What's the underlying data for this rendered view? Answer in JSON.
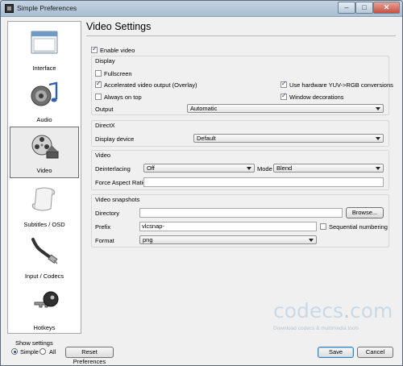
{
  "window": {
    "title": "Simple Preferences"
  },
  "sidebar": {
    "items": [
      {
        "label": "Interface",
        "icon": "interface-icon"
      },
      {
        "label": "Audio",
        "icon": "audio-icon"
      },
      {
        "label": "Video",
        "icon": "video-icon",
        "active": true
      },
      {
        "label": "Subtitles / OSD",
        "icon": "subtitles-icon"
      },
      {
        "label": "Input / Codecs",
        "icon": "input-codecs-icon"
      },
      {
        "label": "Hotkeys",
        "icon": "hotkeys-icon"
      }
    ]
  },
  "show_settings": {
    "label": "Show settings",
    "simple": "Simple",
    "all": "All",
    "selected": "Simple"
  },
  "footer": {
    "reset": "Reset Preferences",
    "save": "Save",
    "cancel": "Cancel"
  },
  "main": {
    "title": "Video Settings",
    "enable_video": {
      "label": "Enable video",
      "checked": true
    },
    "display": {
      "title": "Display",
      "fullscreen": {
        "label": "Fullscreen",
        "checked": false
      },
      "accelerated": {
        "label": "Accelerated video output (Overlay)",
        "checked": true
      },
      "hw_yuv": {
        "label": "Use hardware YUV->RGB conversions",
        "checked": true
      },
      "always_on_top": {
        "label": "Always on top",
        "checked": false
      },
      "window_decorations": {
        "label": "Window decorations",
        "checked": true
      },
      "output_label": "Output",
      "output_value": "Automatic"
    },
    "directx": {
      "title": "DirectX",
      "display_device_label": "Display device",
      "display_device_value": "Default"
    },
    "video": {
      "title": "Video",
      "deinterlacing_label": "Deinterlacing",
      "deinterlacing_value": "Off",
      "mode_label": "Mode",
      "mode_value": "Blend",
      "aspect_label": "Force Aspect Ratio",
      "aspect_value": ""
    },
    "snapshots": {
      "title": "Video snapshots",
      "directory_label": "Directory",
      "directory_value": "",
      "browse": "Browse...",
      "prefix_label": "Prefix",
      "prefix_value": "vlcsnap-",
      "sequential": {
        "label": "Sequential numbering",
        "checked": false
      },
      "format_label": "Format",
      "format_value": "png"
    }
  },
  "watermark": {
    "main_a": "codecs",
    "dot": ".",
    "main_b": "com",
    "sub": "Download codecs & multimedia tools"
  }
}
